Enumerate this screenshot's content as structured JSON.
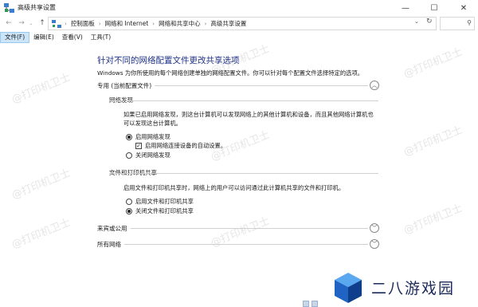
{
  "window": {
    "title": "高级共享设置",
    "min_glyph": "—",
    "max_glyph": "☐",
    "close_glyph": "✕"
  },
  "address": {
    "crumbs": [
      "控制面板",
      "网络和 Internet",
      "网络和共享中心",
      "高级共享设置"
    ],
    "separator": "›",
    "leading_separator": "›",
    "search_placeholder": ""
  },
  "menu": {
    "items": [
      {
        "label": "文件(F)"
      },
      {
        "label": "编辑(E)"
      },
      {
        "label": "查看(V)"
      },
      {
        "label": "工具(T)"
      }
    ]
  },
  "page": {
    "heading": "针对不同的网络配置文件更改共享选项",
    "intro": "Windows 为你所使用的每个网络创建单独的网络配置文件。你可以针对每个配置文件选择特定的选项。"
  },
  "private_profile": {
    "title": "专用 (当前配置文件)",
    "expanded": true,
    "network_discovery": {
      "title": "网络发现",
      "desc_line1": "如果已启用网络发现，则这台计算机可以发现网络上的其他计算机和设备，而且其他网络计算机也",
      "desc_line2": "可以发现这台计算机。",
      "opt_on": "启用网络发现",
      "opt_auto": "启用网络连接设备的自动设置。",
      "opt_off": "关闭网络发现",
      "selected": "on",
      "auto_checked": true
    },
    "file_printer_sharing": {
      "title": "文件和打印机共享",
      "desc": "启用文件和打印机共享时，网络上的用户可以访问通过此计算机共享的文件和打印机。",
      "opt_on": "启用文件和打印机共享",
      "opt_off": "关闭文件和打印机共享",
      "selected": "off"
    }
  },
  "guest_public": {
    "title": "来宾或公用",
    "expanded": false
  },
  "all_networks": {
    "title": "所有网络",
    "expanded": false
  },
  "watermark": "@打印机卫士",
  "badge": {
    "text": "二八游戏园"
  },
  "colors": {
    "heading": "#1e3287",
    "menu_active": "#cce4f7",
    "badge_text": "#1c2a5a"
  }
}
